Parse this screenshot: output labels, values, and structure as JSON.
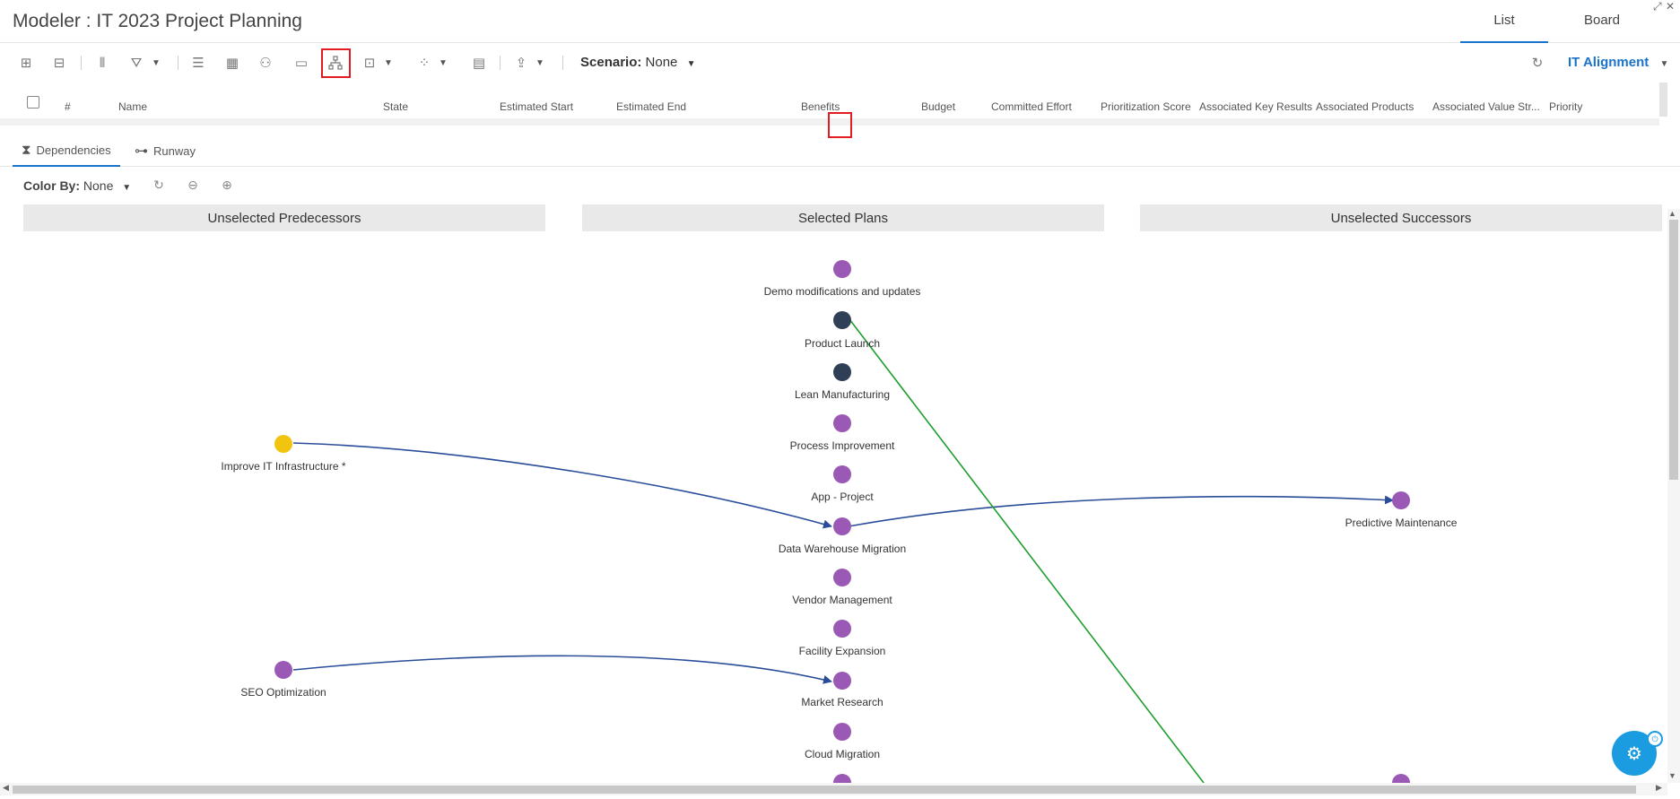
{
  "header": {
    "title": "Modeler : IT 2023 Project Planning",
    "tabs": [
      {
        "label": "List",
        "active": true
      },
      {
        "label": "Board",
        "active": false
      }
    ]
  },
  "toolbar": {
    "icons": [
      "expand-all-icon",
      "collapse-all-icon",
      "columns-icon",
      "filter-icon",
      "gantt-icon",
      "grid-icon",
      "people-icon",
      "money-icon",
      "hierarchy-icon",
      "chart-icon",
      "scatter-icon",
      "report-icon",
      "export-icon"
    ],
    "scenario_label": "Scenario:",
    "scenario_value": "None",
    "alignment_label": "IT Alignment"
  },
  "grid": {
    "columns": [
      "#",
      "Name",
      "State",
      "Estimated Start",
      "Estimated End",
      "Benefits",
      "Budget",
      "Committed Effort",
      "Prioritization Score",
      "Associated Key Results",
      "Associated Products",
      "Associated Value Str...",
      "Priority"
    ]
  },
  "subtabs": [
    {
      "label": "Dependencies",
      "active": true
    },
    {
      "label": "Runway",
      "active": false
    }
  ],
  "controls": {
    "color_by_label": "Color By:",
    "color_by_value": "None"
  },
  "lanes": [
    "Unselected Predecessors",
    "Selected Plans",
    "Unselected Successors"
  ],
  "colors": {
    "accent": "#1a73c8",
    "purple": "#9b59b6",
    "navy": "#2f3f55",
    "yellow": "#f1c40f",
    "link_blue": "#2a4d9a",
    "link_green": "#1e9e2e",
    "highlight": "#e31b23"
  },
  "nodes": {
    "predecessors": [
      {
        "label": "Improve IT Infrastructure *",
        "color": "#f1c40f"
      },
      {
        "label": "SEO Optimization",
        "color": "#9b59b6"
      }
    ],
    "selected": [
      {
        "label": "Demo modifications and updates",
        "color": "#9b59b6"
      },
      {
        "label": "Product Launch",
        "color": "#2f3f55"
      },
      {
        "label": "Lean Manufacturing",
        "color": "#2f3f55"
      },
      {
        "label": "Process Improvement",
        "color": "#9b59b6"
      },
      {
        "label": "App - Project",
        "color": "#9b59b6"
      },
      {
        "label": "Data Warehouse Migration",
        "color": "#9b59b6"
      },
      {
        "label": "Vendor Management",
        "color": "#9b59b6"
      },
      {
        "label": "Facility Expansion",
        "color": "#9b59b6"
      },
      {
        "label": "Market Research",
        "color": "#9b59b6"
      },
      {
        "label": "Cloud Migration",
        "color": "#9b59b6"
      }
    ],
    "successors": [
      {
        "label": "Predictive Maintenance",
        "color": "#9b59b6"
      }
    ]
  }
}
